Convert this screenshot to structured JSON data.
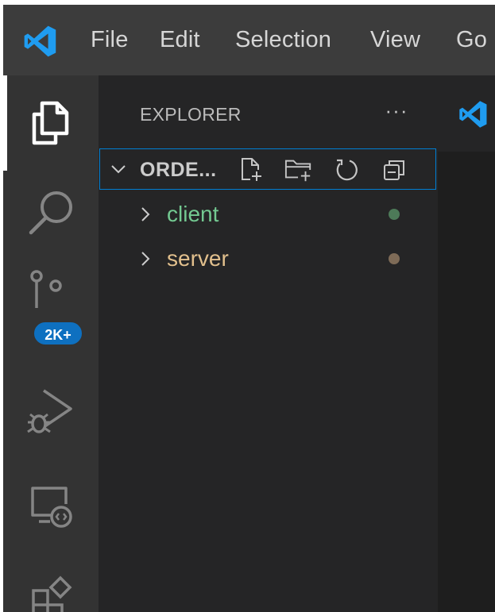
{
  "menu": {
    "items": [
      {
        "label": "File"
      },
      {
        "label": "Edit"
      },
      {
        "label": "Selection"
      },
      {
        "label": "View"
      },
      {
        "label": "Go"
      }
    ]
  },
  "activity_bar": {
    "items": [
      {
        "name": "explorer-icon",
        "active": true
      },
      {
        "name": "search-icon"
      },
      {
        "name": "source-control-icon",
        "badge": "2K+"
      },
      {
        "name": "run-debug-icon"
      },
      {
        "name": "remote-explorer-icon"
      },
      {
        "name": "extensions-icon"
      }
    ]
  },
  "sidebar": {
    "title": "EXPLORER",
    "more_label": "···",
    "folder": {
      "label": "ORDE...",
      "actions": [
        "new-file-icon",
        "new-folder-icon",
        "refresh-icon",
        "collapse-all-icon"
      ]
    },
    "tree": [
      {
        "label": "client",
        "color": "#73c991",
        "dot_color": "#4d7a58"
      },
      {
        "label": "server",
        "color": "#e2c08d",
        "dot_color": "#7e6b57"
      }
    ]
  },
  "colors": {
    "accent": "#007fd4",
    "badge": "#0e70c0",
    "vscode_blue": "#1f9cf0"
  }
}
